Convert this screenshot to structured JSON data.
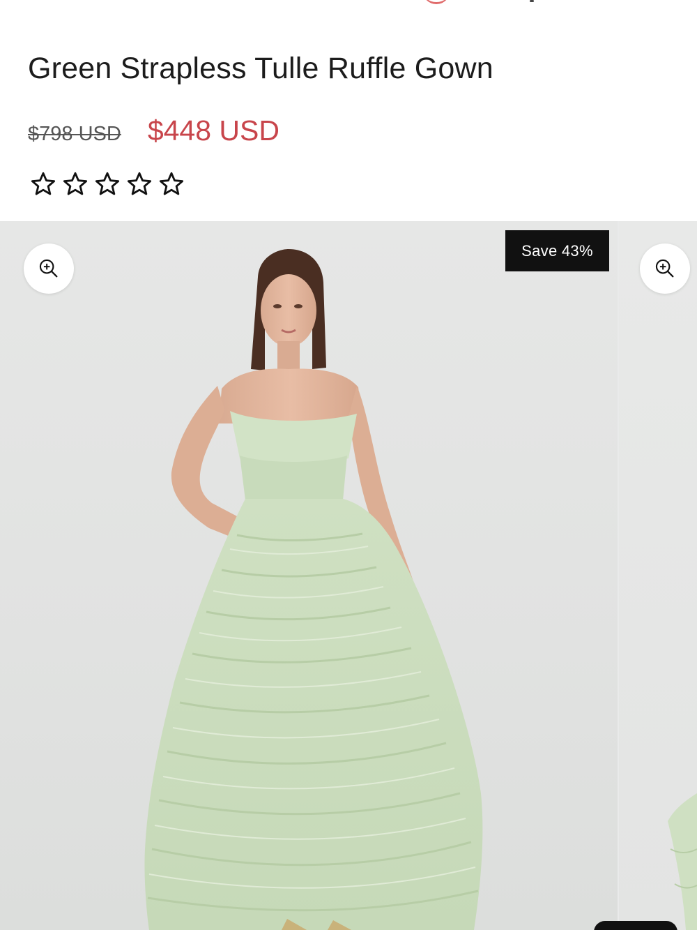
{
  "product": {
    "title": "Green Strapless Tulle Ruffle Gown",
    "price_original": "$798 USD",
    "price_sale": "$448 USD",
    "rating": {
      "value": 0,
      "max": 5
    },
    "badge": "Save 43%"
  },
  "colors": {
    "sale_price": "#c8454b",
    "badge_bg": "#111111",
    "dress": "#cddfc0"
  },
  "icons": {
    "zoom": "zoom-in-icon",
    "star": "star-outline-icon"
  }
}
